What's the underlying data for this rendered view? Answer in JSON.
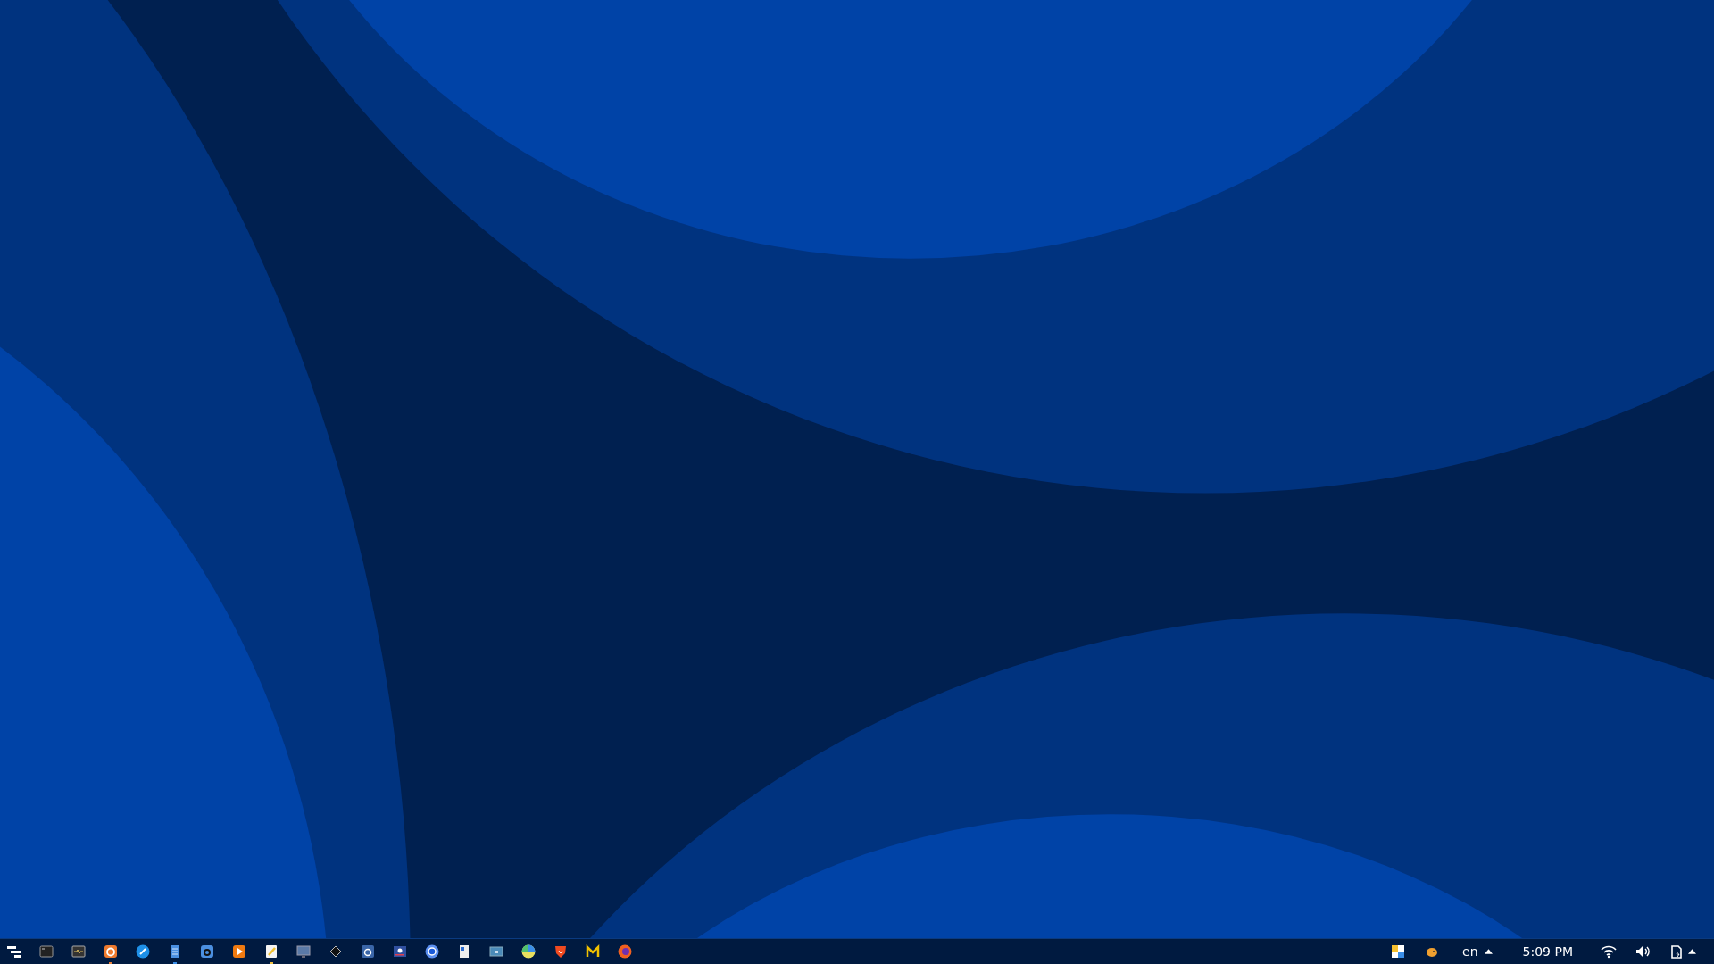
{
  "taskbar": {
    "apps": [
      {
        "kind": "menu",
        "running": false
      },
      {
        "kind": "terminal",
        "running": false
      },
      {
        "kind": "monitor-terminal",
        "running": false
      },
      {
        "kind": "orange-app",
        "running": true
      },
      {
        "kind": "blue-circle",
        "running": false
      },
      {
        "kind": "document",
        "running": true
      },
      {
        "kind": "letter-a",
        "running": false
      },
      {
        "kind": "play",
        "running": false
      },
      {
        "kind": "notepad",
        "running": true
      },
      {
        "kind": "screen",
        "running": false
      },
      {
        "kind": "pen",
        "running": false
      },
      {
        "kind": "camera",
        "running": false
      },
      {
        "kind": "recorder",
        "running": false
      },
      {
        "kind": "ring",
        "running": false
      },
      {
        "kind": "file",
        "running": false
      },
      {
        "kind": "window",
        "running": false
      },
      {
        "kind": "pie",
        "running": false
      },
      {
        "kind": "lion",
        "running": false
      },
      {
        "kind": "letter-m",
        "running": false
      },
      {
        "kind": "fox",
        "running": false
      }
    ],
    "tray": {
      "language": "en",
      "clock": "5:09 PM"
    }
  }
}
